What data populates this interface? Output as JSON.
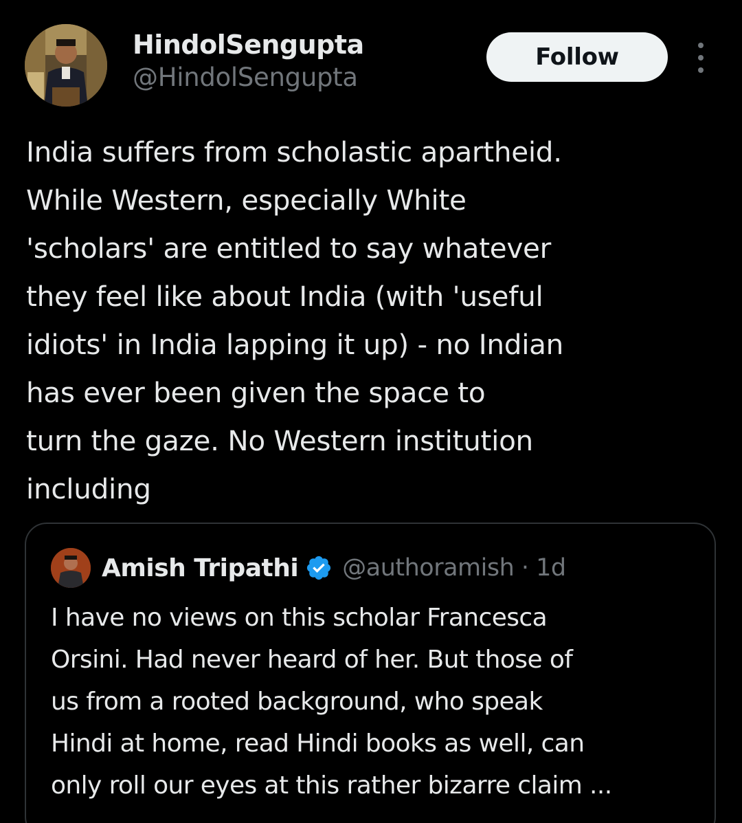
{
  "author": {
    "display_name": "HindolSengupta",
    "handle": "@HindolSengupta"
  },
  "actions": {
    "follow_label": "Follow",
    "more_icon": "more-vertical-icon"
  },
  "tweet": {
    "lines": [
      "India suffers from scholastic apartheid.",
      "While Western, especially White",
      "'scholars' are entitled to say whatever",
      "they feel like about India (with 'useful",
      "idiots' in India lapping it up) - no Indian",
      "has ever been given the space to",
      "turn the gaze. No Western institution",
      "including"
    ]
  },
  "quoted_tweet": {
    "display_name": "Amish Tripathi",
    "verified_icon": "verified-badge-icon",
    "handle_time": "@authoramish · 1d",
    "lines": [
      "I have no views on this scholar Francesca",
      "Orsini. Had never heard of her. But those of",
      "us from a rooted background, who speak",
      "Hindi at home, read Hindi books as well, can",
      "only roll our eyes at this rather bizarre claim ..."
    ]
  },
  "colors": {
    "background": "#000000",
    "text_primary": "#e7e9ea",
    "text_secondary": "#71767b",
    "follow_bg": "#eff3f4",
    "border": "#2f3336",
    "verified": "#1d9bf0"
  }
}
